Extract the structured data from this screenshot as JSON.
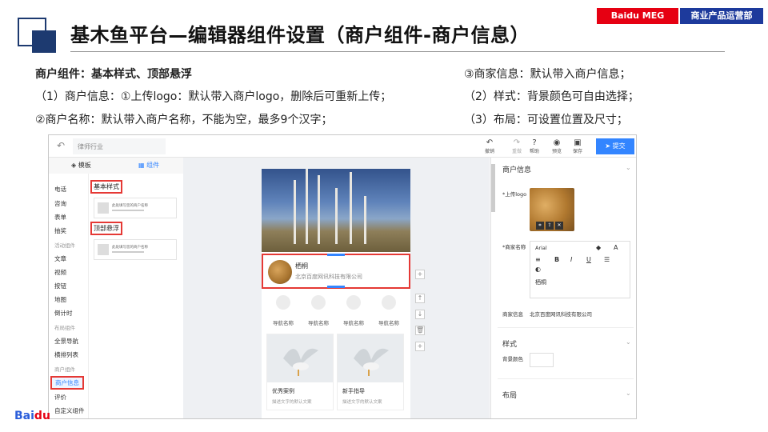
{
  "slide": {
    "title": "基木鱼平台—编辑器组件设置（商户组件-商户信息）",
    "brand_left": "Baidu MEG",
    "brand_right": "商业产品运营部",
    "baidu_logo": "Bai",
    "baidu_logo_rest": "du"
  },
  "description": {
    "heading": "商户组件：基本样式、顶部悬浮",
    "line1": "（1）商户信息：①上传logo：默认带入商户logo，删除后可重新上传；",
    "line2": "②商户名称：默认带入商户名称，不能为空，最多9个汉字；",
    "line3": "③商家信息：默认带入商户信息；",
    "line4": "（2）样式：背景颜色可自由选择；",
    "line5": "（3）布局：可设置位置及尺寸；"
  },
  "app": {
    "industry_value": "律师行业",
    "toolbar": {
      "undo": "撤销",
      "redo": "重做",
      "help": "帮助",
      "preview": "预览",
      "save": "保存",
      "submit": "提交"
    },
    "tabs": {
      "template": "模板",
      "component": "组件"
    },
    "categories": [
      {
        "label": "电话",
        "kind": "item"
      },
      {
        "label": "咨询",
        "kind": "item"
      },
      {
        "label": "表单",
        "kind": "item"
      },
      {
        "label": "抽奖",
        "kind": "item"
      },
      {
        "label": "活动组件",
        "kind": "group"
      },
      {
        "label": "文章",
        "kind": "item"
      },
      {
        "label": "视频",
        "kind": "item"
      },
      {
        "label": "按钮",
        "kind": "item"
      },
      {
        "label": "地图",
        "kind": "item"
      },
      {
        "label": "倒计时",
        "kind": "item"
      },
      {
        "label": "布局组件",
        "kind": "group"
      },
      {
        "label": "全景导航",
        "kind": "item"
      },
      {
        "label": "横排列表",
        "kind": "item"
      },
      {
        "label": "商户组件",
        "kind": "group"
      },
      {
        "label": "商户信息",
        "kind": "selected"
      },
      {
        "label": "评价",
        "kind": "item"
      },
      {
        "label": "自定义组件",
        "kind": "item"
      }
    ],
    "sections": {
      "basic": "基本样式",
      "floating": "顶部悬浮",
      "card_text": "此处填写您的商户名称"
    },
    "preview": {
      "merchant_name": "栖桐",
      "merchant_company": "北京百度网讯科技有限公司",
      "nav_items": [
        "导航名称",
        "导航名称",
        "导航名称",
        "导航名称"
      ],
      "cards": [
        {
          "title": "优秀案例",
          "sub": "描述文字的默认文案"
        },
        {
          "title": "新手指导",
          "sub": "描述文字的默认文案"
        }
      ],
      "side_tools": [
        "+",
        "↑",
        "↓",
        "🗑",
        "+"
      ]
    },
    "right_panel": {
      "merchant_info_title": "商户信息",
      "upload_logo_label": "*上传logo",
      "merchant_name_label": "*商家名称",
      "font": "Arial",
      "merchant_name_value": "栖桐",
      "merchant_detail_label": "商家信息",
      "merchant_detail_value": "北京百度网讯科技有限公司",
      "style_title": "样式",
      "bg_color_label": "背景颜色",
      "layout_title": "布局"
    }
  }
}
